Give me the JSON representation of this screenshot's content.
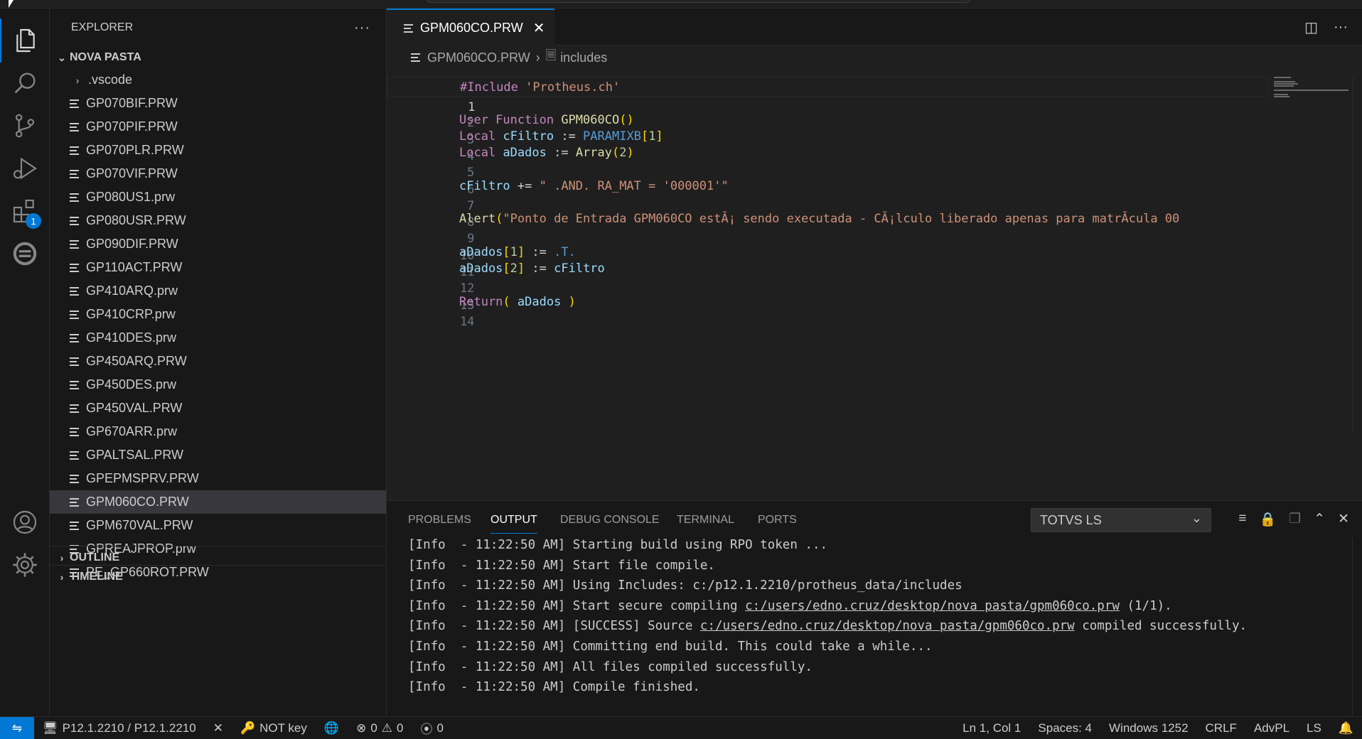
{
  "activity": {
    "explorer_icon": "files-icon",
    "search_icon": "search-icon",
    "scm_icon": "source-control-icon",
    "debug_icon": "run-debug-icon",
    "extensions_icon": "extensions-icon",
    "extensions_badge": "1",
    "totvs_icon": "totvs-icon",
    "accounts_icon": "account-icon",
    "settings_icon": "gear-icon"
  },
  "sidebar": {
    "title": "EXPLORER",
    "folder": "NOVA PASTA",
    "subfolder": ".vscode",
    "files": [
      "GP070BIF.PRW",
      "GP070PIF.PRW",
      "GP070PLR.PRW",
      "GP070VIF.PRW",
      "GP080US1.prw",
      "GP080USR.PRW",
      "GP090DIF.PRW",
      "GP110ACT.PRW",
      "GP410ARQ.prw",
      "GP410CRP.prw",
      "GP410DES.prw",
      "GP450ARQ.PRW",
      "GP450DES.prw",
      "GP450VAL.PRW",
      "GP670ARR.prw",
      "GPALTSAL.PRW",
      "GPEPMSPRV.PRW",
      "GPM060CO.PRW",
      "GPM670VAL.PRW",
      "GPREAJPROP.prw",
      "PE_GP660ROT.PRW"
    ],
    "selected_index": 17,
    "outline": "OUTLINE",
    "timeline": "TIMELINE"
  },
  "editor": {
    "tab_label": "GPM060CO.PRW",
    "breadcrumb_file": "GPM060CO.PRW",
    "breadcrumb_symbol": "includes",
    "line_numbers": [
      "1",
      "2",
      "3",
      "4",
      "5",
      "6",
      "7",
      "8",
      "9",
      "10",
      "11",
      "12",
      "13",
      "14"
    ],
    "code": {
      "l1_kw": "#Include",
      "l1_str": "'Protheus.ch'",
      "l3_kw": "User Function",
      "l3_fn": "GPM060CO",
      "l3_paren": "()",
      "l4_kw": "Local",
      "l4_var": "cFiltro",
      "l4_op": " := ",
      "l4_param": "PARAMIXB",
      "l4_b1": "[",
      "l4_num": "1",
      "l4_b2": "]",
      "l5_kw": "Local",
      "l5_var": "aDados",
      "l5_op": " := ",
      "l5_fn": "Array",
      "l5_b1": "(",
      "l5_num": "2",
      "l5_b2": ")",
      "l7_var": "cFiltro",
      "l7_op": " += ",
      "l7_str": "\" .AND. RA_MAT = '000001'\"",
      "l9_fn": "Alert",
      "l9_b1": "(",
      "l9_str": "\"Ponto de Entrada GPM060CO estÃ¡ sendo executada - CÃ¡lculo liberado apenas para matrÃ­cula 00",
      "l11_var": "aDados",
      "l11_b1": "[",
      "l11_num": "1",
      "l11_b2": "]",
      "l11_op": " := ",
      "l11_const": ".T.",
      "l12_var": "aDados",
      "l12_b1": "[",
      "l12_num": "2",
      "l12_b2": "]",
      "l12_op": " := ",
      "l12_var2": "cFiltro",
      "l14_kw": "Return",
      "l14_b1": "( ",
      "l14_var": "aDados",
      "l14_b2": " )"
    }
  },
  "panel": {
    "tabs": [
      "PROBLEMS",
      "OUTPUT",
      "DEBUG CONSOLE",
      "TERMINAL",
      "PORTS"
    ],
    "active_tab": "OUTPUT",
    "channel": "TOTVS LS",
    "lines": [
      {
        "pre": "[Info  - 11:22:50 AM] Starting build using RPO token ...",
        "link": "",
        "post": ""
      },
      {
        "pre": "[Info  - 11:22:50 AM] Start file compile.",
        "link": "",
        "post": ""
      },
      {
        "pre": "[Info  - 11:22:50 AM] Using Includes: c:/p12.1.2210/protheus_data/includes",
        "link": "",
        "post": ""
      },
      {
        "pre": "[Info  - 11:22:50 AM] Start secure compiling ",
        "link": "c:/users/edno.cruz/desktop/nova pasta/gpm060co.prw",
        "post": " (1/1)."
      },
      {
        "pre": "[Info  - 11:22:50 AM] [SUCCESS] Source ",
        "link": "c:/users/edno.cruz/desktop/nova pasta/gpm060co.prw",
        "post": " compiled successfully."
      },
      {
        "pre": "[Info  - 11:22:50 AM] Committing end build. This could take a while...",
        "link": "",
        "post": ""
      },
      {
        "pre": "[Info  - 11:22:50 AM] All files compiled successfully.",
        "link": "",
        "post": ""
      },
      {
        "pre": "[Info  - 11:22:50 AM] Compile finished.",
        "link": "",
        "post": ""
      }
    ]
  },
  "statusbar": {
    "server": "P12.1.2210 / P12.1.2210",
    "key": "NOT key",
    "errors": "0",
    "warnings": "0",
    "ports": "0",
    "position": "Ln 1, Col 1",
    "spaces": "Spaces: 4",
    "encoding": "Windows 1252",
    "eol": "CRLF",
    "language": "AdvPL",
    "ls": "LS"
  }
}
